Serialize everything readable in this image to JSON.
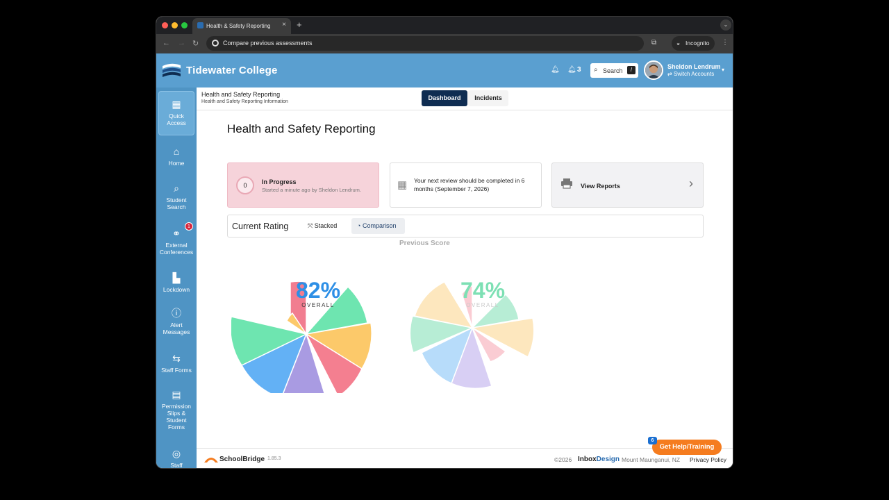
{
  "browser": {
    "tab_title": "Health & Safety Reporting",
    "omnibox_text": "Compare previous assessments",
    "incognito_label": "Incognito"
  },
  "header": {
    "college_name": "Tidewater College",
    "notification_count": "3",
    "search_label": "Search",
    "search_shortcut": "/",
    "user_name": "Sheldon Lendrum",
    "switch_accounts": "Switch Accounts"
  },
  "sidebar": {
    "items": [
      {
        "label": "Quick Access",
        "icon": "grid-icon"
      },
      {
        "label": "Home",
        "icon": "home-icon"
      },
      {
        "label": "Student Search",
        "icon": "search-icon"
      },
      {
        "label": "External Conferences",
        "icon": "handshake-icon",
        "badge": "1"
      },
      {
        "label": "Lockdown",
        "icon": "lockdown-icon"
      },
      {
        "label": "Alert Messages",
        "icon": "alert-icon"
      },
      {
        "label": "Staff Forms",
        "icon": "forms-icon"
      },
      {
        "label": "Permission Slips & Student Forms",
        "icon": "document-icon"
      },
      {
        "label": "Staff",
        "icon": "target-icon"
      }
    ]
  },
  "subheader": {
    "title": "Health and Safety Reporting",
    "subtitle": "Health and Safety Reporting Information",
    "tabs": [
      "Dashboard",
      "Incidents"
    ]
  },
  "page": {
    "title": "Health and Safety Reporting"
  },
  "cards": {
    "progress_count": "0",
    "progress_title": "In Progress",
    "progress_sub": "Started a minute ago by Sheldon Lendrum.",
    "review_text": "Your next review should be completed in 6 months (September 7, 2026)",
    "reports_label": "View Reports"
  },
  "rating": {
    "title": "Current Rating",
    "tab_stacked": "Stacked",
    "tab_comparison": "Comparison",
    "previous_label": "Previous Score",
    "current_percent": "82%",
    "previous_percent": "74%",
    "overall_label": "OVERALL"
  },
  "colors": {
    "brand_blue": "#5a9fd0",
    "sidebar_blue": "#4f94c4",
    "dashboard_navy": "#0f2d52",
    "percent_blue": "#2d8fe6",
    "percent_green": "#7de0b4",
    "help_orange": "#f57c1f"
  },
  "footer": {
    "brand": "SchoolBridge",
    "version": "1.85.3",
    "copyright": "©2026",
    "designer_a": "Inbox",
    "designer_b": "Design",
    "location": "Mount Maunganui, NZ",
    "privacy": "Privacy Policy",
    "help_label": "Get Help/Training",
    "help_badge": "6"
  }
}
